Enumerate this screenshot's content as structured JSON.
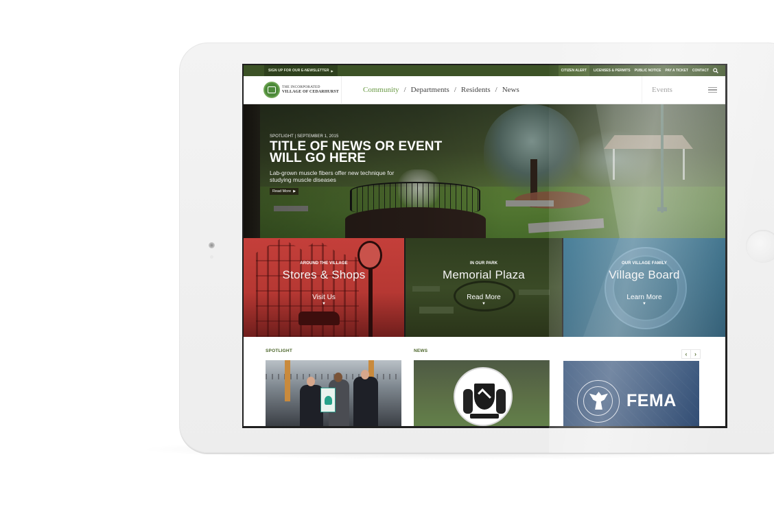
{
  "utility_bar": {
    "newsletter_label": "Sign up for our E-Newsletter",
    "newsletter_icon": "triangle-right",
    "links": [
      "Citizen Alert",
      "Licenses & Permits",
      "Public Notice",
      "Pay a Ticket",
      "Contact"
    ],
    "search_icon": "search-icon"
  },
  "header": {
    "logo_line1": "The Incorporated",
    "logo_line2": "Village of Cedarhurst",
    "nav": [
      "Community",
      "Departments",
      "Residents",
      "News"
    ],
    "nav_separator": "/",
    "events_label": "Events",
    "menu_icon": "hamburger-icon"
  },
  "hero": {
    "kicker": "Spotlight | September 1, 2015",
    "title_line1": "Title of News or Event",
    "title_line2": "Will Go Here",
    "description": "Lab-grown muscle fibers offer new technique for studying muscle diseases",
    "button_label": "Read More",
    "button_icon": "▶"
  },
  "tiles": [
    {
      "kicker": "Around the Village",
      "title": "Stores & Shops",
      "cta": "Visit Us",
      "arrow": "▼",
      "color": "#c43f3a"
    },
    {
      "kicker": "In Our Park",
      "title": "Memorial Plaza",
      "cta": "Read More",
      "arrow": "▼",
      "color": "#3a4a26"
    },
    {
      "kicker": "Our Village Family",
      "title": "Village Board",
      "cta": "Learn More",
      "arrow": "▼",
      "color": "#215b78"
    }
  ],
  "lower": {
    "spotlight_label": "Spotlight",
    "news_label": "News",
    "prev_icon": "‹",
    "next_icon": "›",
    "fema_text": "FEMA"
  },
  "colors": {
    "brand_green": "#3c5226",
    "accent_green": "#6a9a45",
    "label_green": "#4a6428"
  }
}
